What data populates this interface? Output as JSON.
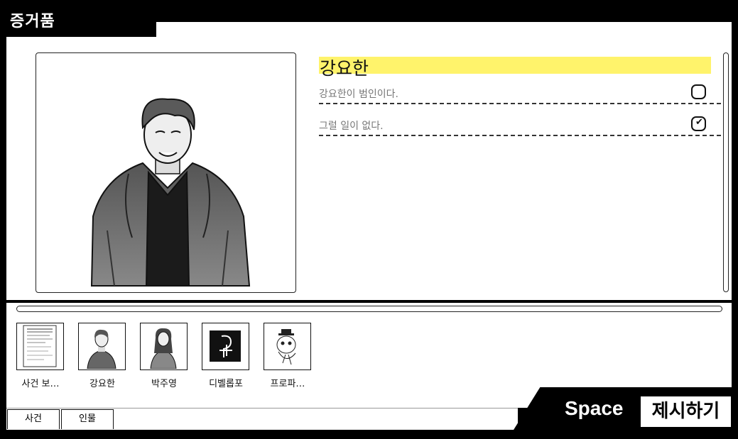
{
  "window": {
    "title": "증거품"
  },
  "evidence": {
    "name": "강요한",
    "options": [
      {
        "text": "강요한이 범인이다.",
        "checked": false
      },
      {
        "text": "그럴 일이 없다.",
        "checked": true
      }
    ]
  },
  "thumbnails": [
    {
      "label": "사건 보…",
      "icon": "document-icon"
    },
    {
      "label": "강요한",
      "icon": "person-man-icon"
    },
    {
      "label": "박주영",
      "icon": "person-woman-icon"
    },
    {
      "label": "디벨롭포",
      "icon": "logo-icon"
    },
    {
      "label": "프로파…",
      "icon": "mascot-icon"
    }
  ],
  "tabs": {
    "case": "사건",
    "people": "인물"
  },
  "present": {
    "key": "Space",
    "label": "제시하기"
  },
  "colors": {
    "highlight": "#fff36b",
    "background": "#000000",
    "panel": "#ffffff"
  }
}
